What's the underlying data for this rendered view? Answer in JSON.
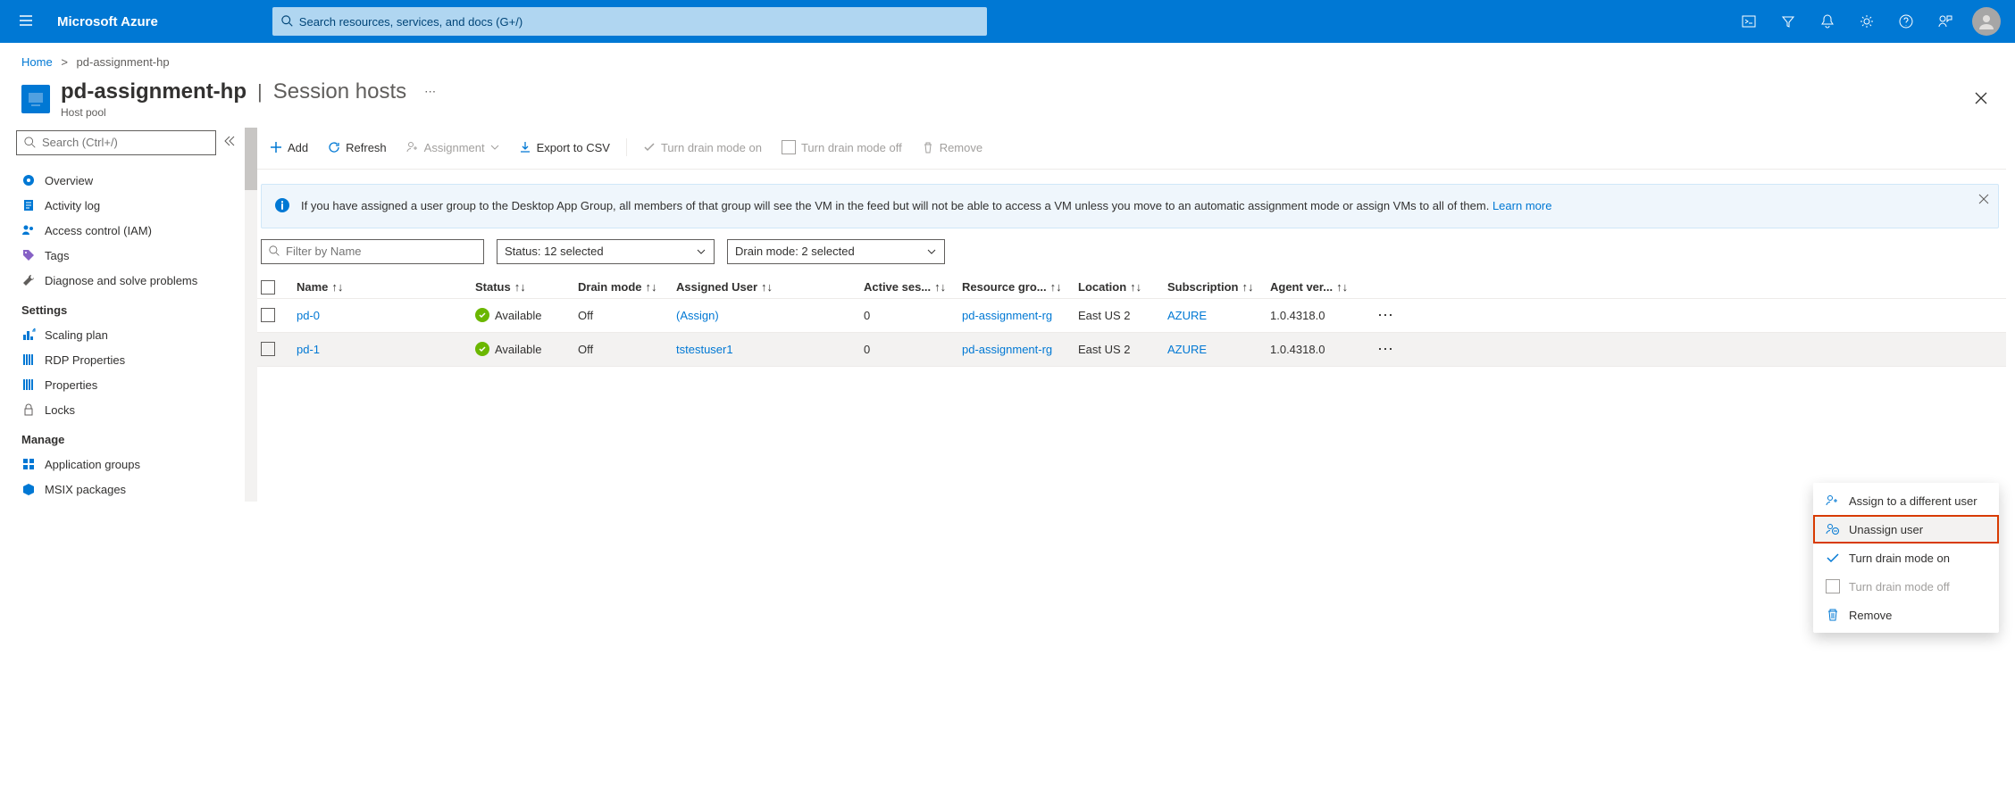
{
  "topbar": {
    "brand": "Microsoft Azure",
    "search_placeholder": "Search resources, services, and docs (G+/)"
  },
  "breadcrumb": {
    "home": "Home",
    "current": "pd-assignment-hp"
  },
  "header": {
    "title": "pd-assignment-hp",
    "section": "Session hosts",
    "subtitle": "Host pool"
  },
  "sidebar": {
    "search_placeholder": "Search (Ctrl+/)",
    "items_top": [
      {
        "label": "Overview"
      },
      {
        "label": "Activity log"
      },
      {
        "label": "Access control (IAM)"
      },
      {
        "label": "Tags"
      },
      {
        "label": "Diagnose and solve problems"
      }
    ],
    "section_settings": "Settings",
    "items_settings": [
      {
        "label": "Scaling plan"
      },
      {
        "label": "RDP Properties"
      },
      {
        "label": "Properties"
      },
      {
        "label": "Locks"
      }
    ],
    "section_manage": "Manage",
    "items_manage": [
      {
        "label": "Application groups"
      },
      {
        "label": "MSIX packages"
      }
    ]
  },
  "toolbar": {
    "add": "Add",
    "refresh": "Refresh",
    "assignment": "Assignment",
    "export": "Export to CSV",
    "drain_on": "Turn drain mode on",
    "drain_off": "Turn drain mode off",
    "remove": "Remove"
  },
  "info_banner": {
    "text": "If you have assigned a user group to the Desktop App Group, all members of that group will see the VM in the feed but will not be able to access a VM unless you move to an automatic assignment mode or assign VMs to all of them.",
    "learn_more": "Learn more"
  },
  "filters": {
    "name_placeholder": "Filter by Name",
    "status": "Status: 12 selected",
    "drain": "Drain mode: 2 selected"
  },
  "columns": {
    "name": "Name",
    "status": "Status",
    "drain": "Drain mode",
    "user": "Assigned User",
    "sessions": "Active ses...",
    "rg": "Resource gro...",
    "loc": "Location",
    "sub": "Subscription",
    "agent": "Agent ver..."
  },
  "rows": [
    {
      "name": "pd-0",
      "status": "Available",
      "drain": "Off",
      "user": "(Assign)",
      "user_is_link": true,
      "sessions": "0",
      "rg": "pd-assignment-rg",
      "loc": "East US 2",
      "sub": "AZURE",
      "agent": "1.0.4318.0"
    },
    {
      "name": "pd-1",
      "status": "Available",
      "drain": "Off",
      "user": "tstestuser1",
      "user_is_link": true,
      "sessions": "0",
      "rg": "pd-assignment-rg",
      "loc": "East US 2",
      "sub": "AZURE",
      "agent": "1.0.4318.0"
    }
  ],
  "context_menu": {
    "assign_other": "Assign to a different user",
    "unassign": "Unassign user",
    "drain_on": "Turn drain mode on",
    "drain_off": "Turn drain mode off",
    "remove": "Remove"
  }
}
